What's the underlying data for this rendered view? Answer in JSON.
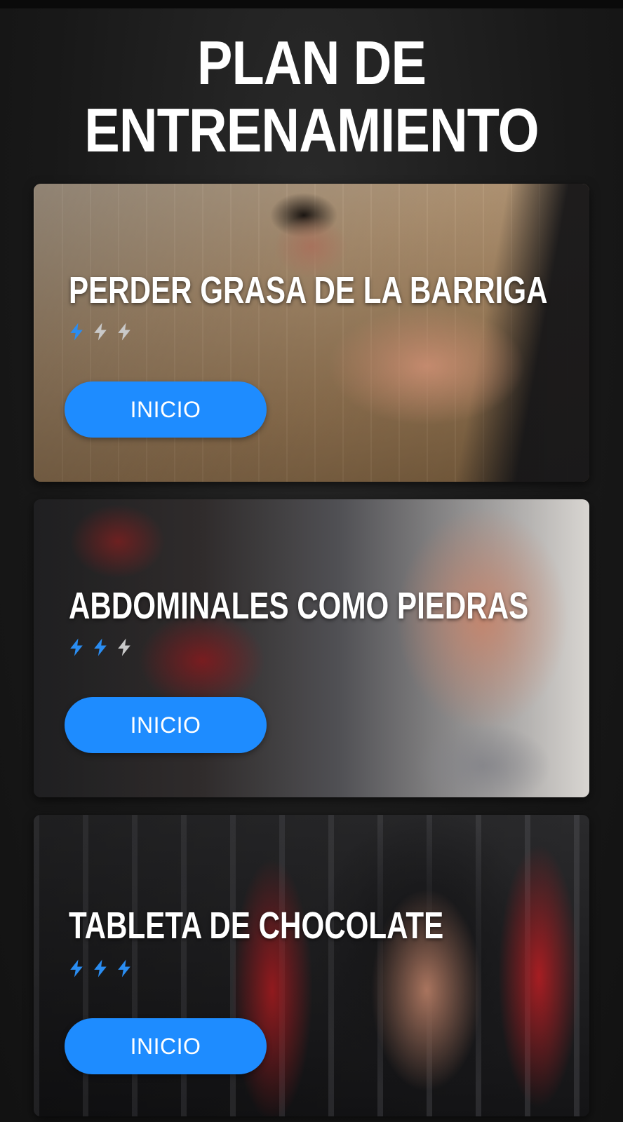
{
  "header": {
    "title_line1": "PLAN DE",
    "title_line2": "ENTRENAMIENTO"
  },
  "colors": {
    "accent": "#1e8cff",
    "bolt_active": "#2a8df2",
    "bolt_inactive": "#c9c9c9",
    "background": "#1c1c1c"
  },
  "plans": [
    {
      "title": "PERDER GRASA DE LA BARRIGA",
      "difficulty": 1,
      "max_difficulty": 3,
      "button_label": "INICIO"
    },
    {
      "title": "ABDOMINALES COMO PIEDRAS",
      "difficulty": 2,
      "max_difficulty": 3,
      "button_label": "INICIO"
    },
    {
      "title": "TABLETA DE CHOCOLATE",
      "difficulty": 3,
      "max_difficulty": 3,
      "button_label": "INICIO"
    }
  ]
}
